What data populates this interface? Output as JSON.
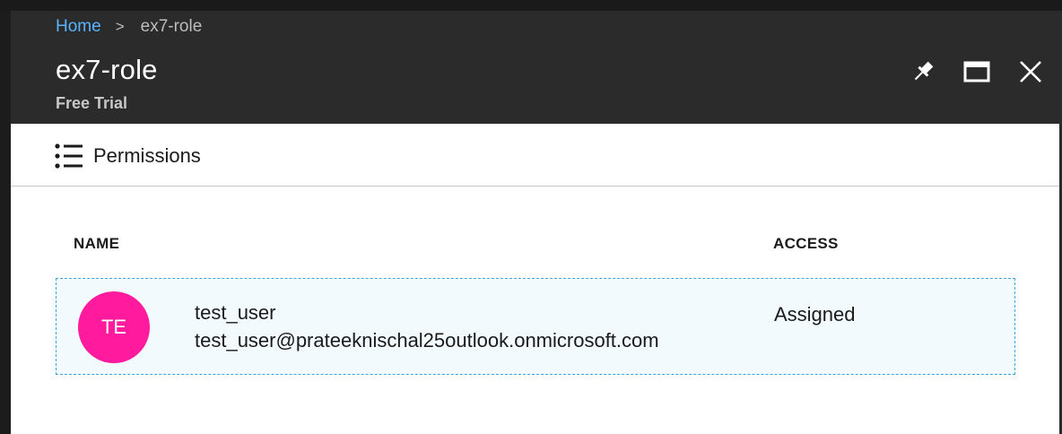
{
  "breadcrumb": {
    "home": "Home",
    "separator": ">",
    "current": "ex7-role"
  },
  "blade": {
    "title": "ex7-role",
    "subtitle": "Free Trial",
    "actions": [
      "pin-icon",
      "maximize-icon",
      "close-icon"
    ]
  },
  "command_bar": {
    "permissions_label": "Permissions",
    "permissions_icon": "list-icon"
  },
  "table": {
    "columns": [
      "NAME",
      "ACCESS"
    ],
    "rows": [
      {
        "avatar_initials": "TE",
        "avatar_color": "#ff1a9e",
        "name": "test_user",
        "email": "test_user@prateeknischal25outlook.onmicrosoft.com",
        "access": "Assigned"
      }
    ]
  },
  "colors": {
    "link": "#59b4ff",
    "header_bg": "#2b2b2b",
    "row_highlight": "#f2fafd",
    "row_border": "#3aa6e0"
  }
}
